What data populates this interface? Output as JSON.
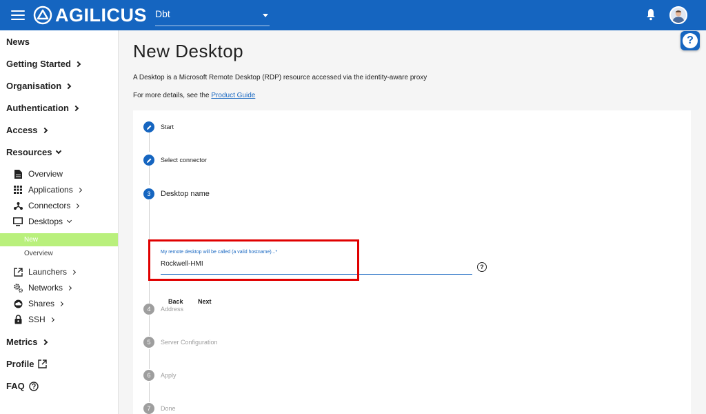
{
  "header": {
    "logo_text": "AGILICUS",
    "org_select_value": "Dbt"
  },
  "help_icon_text": "?",
  "sidebar": {
    "top_items": [
      {
        "label": "News"
      },
      {
        "label": "Getting Started"
      },
      {
        "label": "Organisation"
      },
      {
        "label": "Authentication"
      },
      {
        "label": "Access"
      },
      {
        "label": "Resources"
      }
    ],
    "resources": [
      {
        "label": "Overview",
        "icon": "document-icon"
      },
      {
        "label": "Applications",
        "icon": "apps-grid-icon"
      },
      {
        "label": "Connectors",
        "icon": "connector-icon"
      },
      {
        "label": "Desktops",
        "icon": "monitor-icon"
      }
    ],
    "desktops_sub": [
      {
        "label": "New",
        "active": true
      },
      {
        "label": "Overview",
        "active": false
      }
    ],
    "resources_more": [
      {
        "label": "Launchers",
        "icon": "launch-icon"
      },
      {
        "label": "Networks",
        "icon": "gears-icon"
      },
      {
        "label": "Shares",
        "icon": "cloud-icon"
      },
      {
        "label": "SSH",
        "icon": "lock-icon"
      }
    ],
    "bottom_items": [
      {
        "label": "Metrics"
      },
      {
        "label": "Profile"
      },
      {
        "label": "FAQ"
      }
    ]
  },
  "main": {
    "title": "New Desktop",
    "description": "A Desktop is a Microsoft Remote Desktop (RDP) resource accessed via the identity-aware proxy",
    "more_prefix": "For more details, see the ",
    "more_link": "Product Guide"
  },
  "stepper": {
    "steps": [
      {
        "number": "1",
        "label": "Start",
        "state": "done"
      },
      {
        "number": "2",
        "label": "Select connector",
        "state": "done"
      },
      {
        "number": "3",
        "label": "Desktop name",
        "state": "current"
      },
      {
        "number": "4",
        "label": "Address",
        "state": "todo"
      },
      {
        "number": "5",
        "label": "Server Configuration",
        "state": "todo"
      },
      {
        "number": "6",
        "label": "Apply",
        "state": "todo"
      },
      {
        "number": "7",
        "label": "Done",
        "state": "todo"
      }
    ],
    "field_label": "My remote desktop will be called (a valid hostname)...*",
    "field_value": "Rockwell-HMI",
    "field_help": "?",
    "back_label": "Back",
    "next_label": "Next"
  },
  "colors": {
    "primary": "#1565c0",
    "active_nav": "#b9f07c",
    "highlight": "#e00000"
  }
}
